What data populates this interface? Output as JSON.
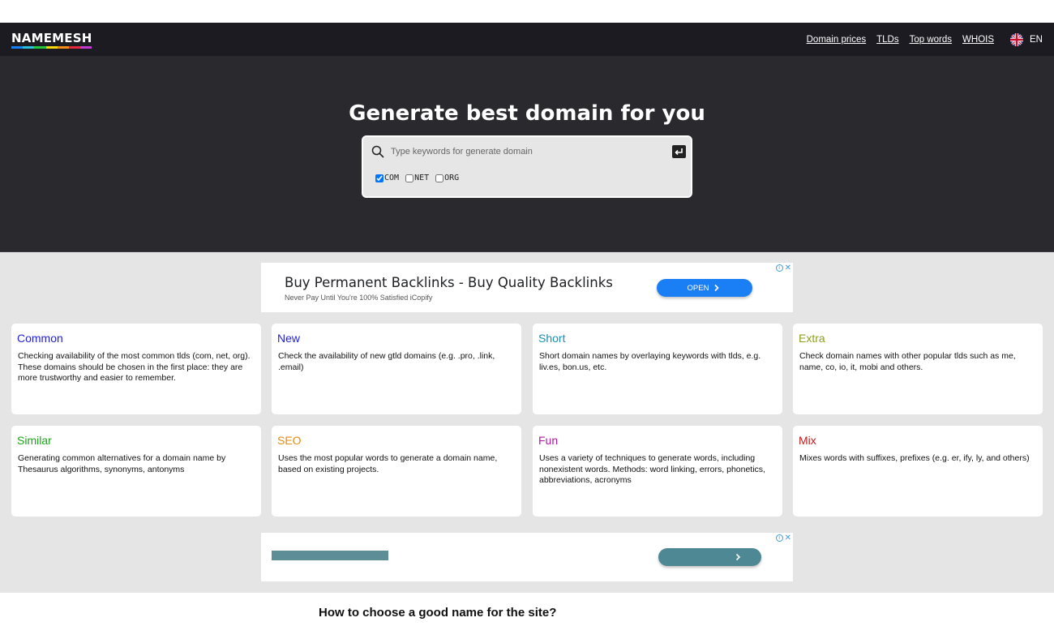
{
  "brand": {
    "logo_text": "NAMEMESH",
    "logo_bar_colors": [
      "#1a7ef5",
      "#2ac0e0",
      "#23c840",
      "#f5d90a",
      "#f58d1a",
      "#e8283c",
      "#c03ad1"
    ]
  },
  "nav": {
    "links": [
      "Domain prices",
      "TLDs",
      "Top words",
      "WHOIS"
    ],
    "language": "EN"
  },
  "hero": {
    "title": "Generate best domain for you",
    "search_placeholder": "Type keywords for generate domain",
    "tlds": [
      {
        "label": "COM",
        "checked": true
      },
      {
        "label": "NET",
        "checked": false
      },
      {
        "label": "ORG",
        "checked": false
      }
    ]
  },
  "ad_top": {
    "title": "Buy Permanent Backlinks - Buy Quality Backlinks",
    "subtitle": "Never Pay Until You're 100% Satisfied iCopify",
    "button_label": "OPEN"
  },
  "categories": [
    {
      "title": "Common",
      "color": "#1f1fd4",
      "desc": "Checking availability of the most common tlds (com, net, org). These domains should be chosen in the first place: they are more trustworthy and easier to remember."
    },
    {
      "title": "New",
      "color": "#1f1fd4",
      "desc": "Check the availability of new gtld domains (e.g. .pro, .link, .email)"
    },
    {
      "title": "Short",
      "color": "#1a8fb0",
      "desc": "Short domain names by overlaying keywords with tlds, e.g. liv.es, bon.us, etc."
    },
    {
      "title": "Extra",
      "color": "#8aa11b",
      "desc": "Check domain names with other popular tlds such as me, name, co, io, it, mobi and others."
    },
    {
      "title": "Similar",
      "color": "#1aa51a",
      "desc": "Generating common alternatives for a domain name by Thesaurus algorithms, synonyms, antonyms"
    },
    {
      "title": "SEO",
      "color": "#e88a10",
      "desc": "Uses the most popular words to generate a domain name, based on existing projects."
    },
    {
      "title": "Fun",
      "color": "#b01aa8",
      "desc": "Uses a variety of techniques to generate words, including nonexistent words. Methods: word linking, errors, phonetics, abbreviations, acronyms"
    },
    {
      "title": "Mix",
      "color": "#c41a1a",
      "desc": "Mixes words with suffixes, prefixes (e.g. er, ify, ly, and others)"
    }
  ],
  "section_heading": "How to choose a good name for the site?"
}
